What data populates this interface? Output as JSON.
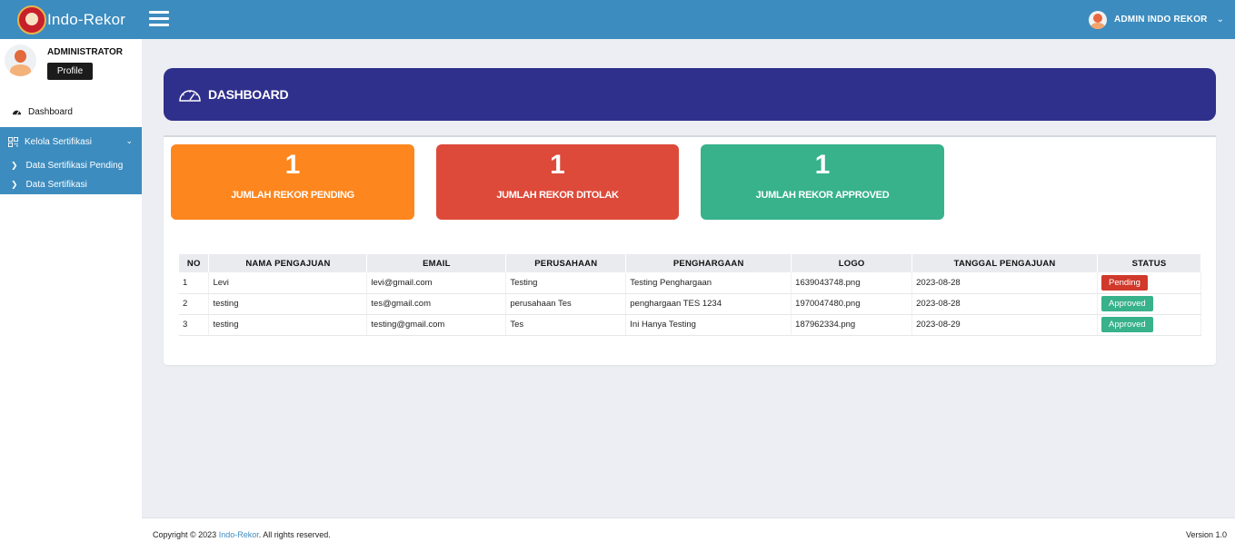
{
  "topbar": {
    "brand": "Indo-Rekor",
    "user_name": "ADMIN INDO REKOR"
  },
  "sidebar": {
    "profile_name": "ADMINISTRATOR",
    "profile_button": "Profile",
    "dashboard": "Dashboard",
    "group_label": "Kelola Sertifikasi",
    "sub_items": [
      "Data Sertifikasi Pending",
      "Data Sertifikasi"
    ]
  },
  "banner": {
    "title": "DASHBOARD"
  },
  "stats": [
    {
      "value": "1",
      "label": "JUMLAH REKOR PENDING",
      "color": "#fd861e"
    },
    {
      "value": "1",
      "label": "JUMLAH REKOR DITOLAK",
      "color": "#dd4a3a"
    },
    {
      "value": "1",
      "label": "JUMLAH REKOR APPROVED",
      "color": "#37b28a"
    }
  ],
  "table": {
    "headers": [
      "NO",
      "NAMA PENGAJUAN",
      "EMAIL",
      "PERUSAHAAN",
      "PENGHARGAAN",
      "LOGO",
      "TANGGAL PENGAJUAN",
      "STATUS"
    ],
    "rows": [
      [
        "1",
        "Levi",
        "levi@gmail.com",
        "Testing",
        "Testing Penghargaan",
        "1639043748.png",
        "2023-08-28",
        "Pending"
      ],
      [
        "2",
        "testing",
        "tes@gmail.com",
        "perusahaan Tes",
        "penghargaan TES 1234",
        "1970047480.png",
        "2023-08-28",
        "Approved"
      ],
      [
        "3",
        "testing",
        "testing@gmail.com",
        "Tes",
        "Ini Hanya Testing",
        "187962334.png",
        "2023-08-29",
        "Approved"
      ]
    ]
  },
  "footer": {
    "copyright_prefix": "Copyright © 2023 ",
    "copyright_link": "Indo-Rekor",
    "copyright_suffix": ". All rights reserved.",
    "version": "Version 1.0"
  },
  "colors": {
    "topbar": "#3c8cbf",
    "banner": "#2f2f8c",
    "pending": "#d0392b",
    "approved": "#37b28a"
  }
}
